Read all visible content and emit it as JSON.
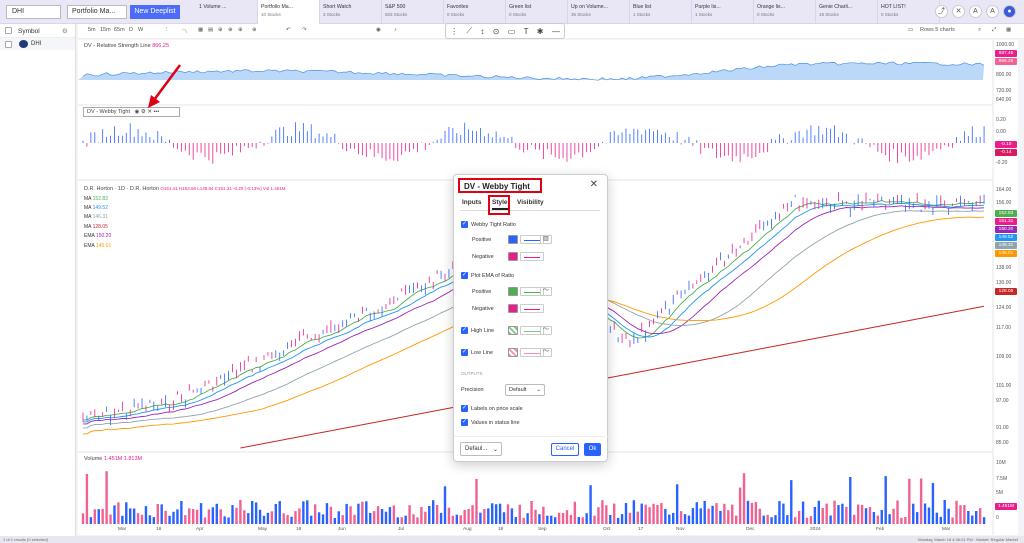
{
  "topbar": {
    "ticker": "DHI",
    "portfolio": "Portfolio Ma...",
    "new_deeplist": "New Deeplist",
    "tabs": [
      {
        "label": "1 Volume ...",
        "sub": ""
      },
      {
        "label": "Portfolio Ma...",
        "sub": "10 Stocks"
      },
      {
        "label": "Short Watch",
        "sub": "3 Stocks"
      },
      {
        "label": "S&P 500",
        "sub": "503 Stocks"
      },
      {
        "label": "Favorites",
        "sub": "0 Stocks"
      },
      {
        "label": "Green list",
        "sub": "0 Stocks"
      },
      {
        "label": "Up on Volume...",
        "sub": "36 Stocks"
      },
      {
        "label": "Blue list",
        "sub": "1 Stocks"
      },
      {
        "label": "Purple lis...",
        "sub": "1 Stocks"
      },
      {
        "label": "Orange lis...",
        "sub": "0 Stocks"
      },
      {
        "label": "Genie Charli...",
        "sub": "19 Stocks"
      },
      {
        "label": "HOT LIST!",
        "sub": "0 Stocks"
      }
    ]
  },
  "sidebar": {
    "header": "Symbol",
    "row_symbol": "DHI"
  },
  "toolbar": {
    "timeframes": [
      "5m",
      "15m",
      "65m",
      "D",
      "W"
    ],
    "rows_label": "Rows 5 charts"
  },
  "panes": {
    "rs_title": "DV - Relative Strength Line",
    "rs_value": "866.25",
    "wt_title": "DV - Webby Tight",
    "price_title": "D.R. Horton · 1D · D.R. Horton",
    "price_ohlc": "O151.41 H153.66 L149.84 C151.31 -0.20 (-0.13%) Vol 1.451M",
    "ma_legend": [
      {
        "name": "MA",
        "value": "152.83",
        "color": "#4caf50"
      },
      {
        "name": "MA",
        "value": "149.52",
        "color": "#2196f3"
      },
      {
        "name": "MA",
        "value": "146.31",
        "color": "#90a4ae"
      },
      {
        "name": "MA",
        "value": "128.05",
        "color": "#c62828"
      },
      {
        "name": "EMA",
        "value": "150.20",
        "color": "#9c27b0"
      },
      {
        "name": "EMA",
        "value": "145.01",
        "color": "#ff9800"
      }
    ],
    "volume_title": "Volume",
    "volume_value": "1.451M 1.813M"
  },
  "axes": {
    "rs_ticks": [
      "1000.00",
      "887.45",
      "866.25",
      "800.00",
      "720.00",
      "640.00"
    ],
    "wt_ticks": [
      "0.20",
      "0.00",
      "-0.10",
      "-0.14",
      "-0.20"
    ],
    "price_ticks": [
      "164.00",
      "156.00",
      "152.83",
      "151.31",
      "150.20",
      "149.52",
      "146.31",
      "145.01",
      "138.00",
      "130.00",
      "128.05",
      "124.00",
      "117.00",
      "109.00",
      "101.00",
      "97.00",
      "91.00",
      "85.00"
    ],
    "volume_ticks": [
      "10M",
      "7.5M",
      "5M",
      "1.451M",
      "0"
    ],
    "months": [
      "Mar",
      "16",
      "Apr",
      "May",
      "16",
      "Jun",
      "Jul",
      "Aug",
      "16",
      "Sep",
      "Oct",
      "17",
      "Nov",
      "Dec",
      "2024",
      "Feb",
      "Mar"
    ]
  },
  "dialog": {
    "title": "DV - Webby Tight",
    "tabs": [
      "Inputs",
      "Style",
      "Visibility"
    ],
    "webby_ratio": "Webby Tight Ratio",
    "positive": "Positive",
    "negative": "Negative",
    "plot_ema": "Plot EMA of Ratio",
    "high_line": "High Line",
    "low_line": "Low Line",
    "outputs": "OUTPUTS",
    "precision": "Precision",
    "precision_value": "Default",
    "labels_scale": "Labels on price scale",
    "values_status": "Values in status line",
    "defaults_btn": "Defaul...",
    "cancel_btn": "Cancel",
    "ok_btn": "Ok"
  },
  "status": {
    "left": "1 of 1 results (0 selected)",
    "right": "Monday, March 18 4:36:01 PM  ·  Market: Regular Market"
  },
  "colors": {
    "accent": "#2962ff",
    "highlight_red": "#e00014",
    "positive_blue": "#2962ff",
    "negative_pink": "#e91e8c",
    "ema_green": "#4caf50"
  }
}
